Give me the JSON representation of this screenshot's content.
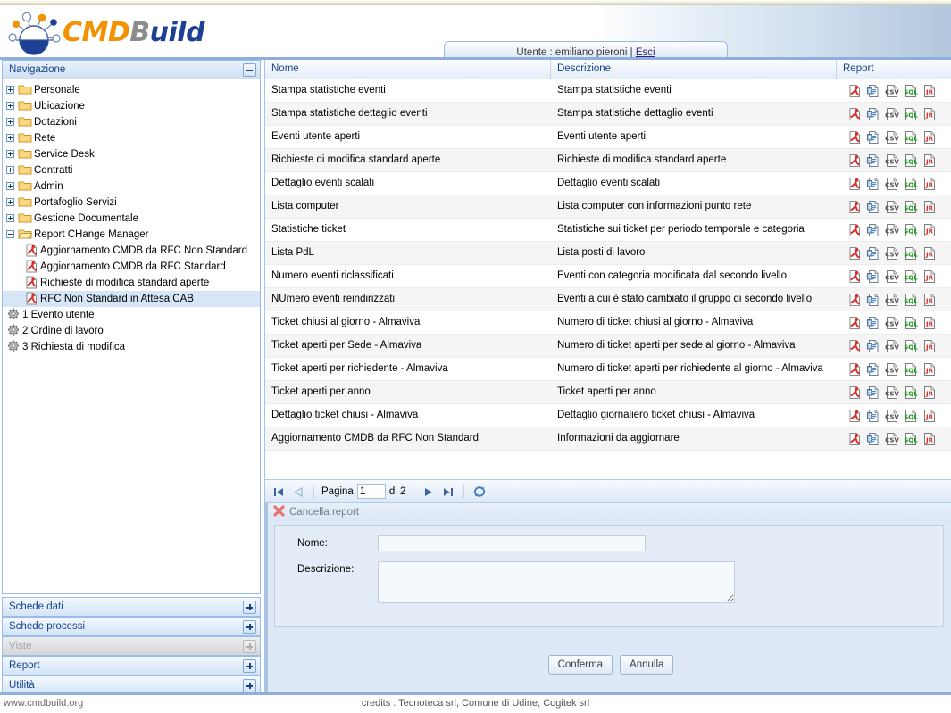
{
  "brand": {
    "name_part1": "CMD",
    "name_part2": "B",
    "name_part3": "uild",
    "colors": {
      "orange": "#f39200",
      "grey": "#8c8c8c",
      "blue": "#1d3f94"
    }
  },
  "header": {
    "user_prefix": "Utente : ",
    "user_name": "emiliano pieroni",
    "separator": " | ",
    "logout_label": "Esci"
  },
  "sidebar": {
    "title": "Navigazione",
    "tree": [
      {
        "label": "Personale",
        "icon": "folder-icon",
        "state": "plus",
        "depth": 0,
        "selected": false
      },
      {
        "label": "Ubicazione",
        "icon": "folder-icon",
        "state": "plus",
        "depth": 0,
        "selected": false
      },
      {
        "label": "Dotazioni",
        "icon": "folder-icon",
        "state": "plus",
        "depth": 0,
        "selected": false
      },
      {
        "label": "Rete",
        "icon": "folder-icon",
        "state": "plus",
        "depth": 0,
        "selected": false
      },
      {
        "label": "Service Desk",
        "icon": "folder-icon",
        "state": "plus",
        "depth": 0,
        "selected": false
      },
      {
        "label": "Contratti",
        "icon": "folder-icon",
        "state": "plus",
        "depth": 0,
        "selected": false
      },
      {
        "label": "Admin",
        "icon": "folder-icon",
        "state": "plus",
        "depth": 0,
        "selected": false
      },
      {
        "label": "Portafoglio Servizi",
        "icon": "folder-icon",
        "state": "plus",
        "depth": 0,
        "selected": false
      },
      {
        "label": "Gestione Documentale",
        "icon": "folder-icon",
        "state": "plus",
        "depth": 0,
        "selected": false
      },
      {
        "label": "Report CHange Manager",
        "icon": "folder-open-icon",
        "state": "minus",
        "depth": 0,
        "selected": false
      },
      {
        "label": "Aggiornamento CMDB da RFC Non Standard",
        "icon": "pdf-icon",
        "state": "none",
        "depth": 1,
        "selected": false
      },
      {
        "label": "Aggiornamento CMDB da RFC Standard",
        "icon": "pdf-icon",
        "state": "none",
        "depth": 1,
        "selected": false
      },
      {
        "label": "Richieste di modifica standard aperte",
        "icon": "pdf-icon",
        "state": "none",
        "depth": 1,
        "selected": false
      },
      {
        "label": "RFC Non Standard in Attesa CAB",
        "icon": "pdf-icon",
        "state": "none",
        "depth": 1,
        "selected": true
      },
      {
        "label": "1 Evento utente",
        "icon": "gear-icon",
        "state": "none",
        "depth": 0,
        "selected": false
      },
      {
        "label": "2 Ordine di lavoro",
        "icon": "gear-icon",
        "state": "none",
        "depth": 0,
        "selected": false
      },
      {
        "label": "3 Richiesta di modifica",
        "icon": "gear-icon",
        "state": "none",
        "depth": 0,
        "selected": false
      }
    ],
    "accordions": [
      {
        "label": "Schede dati",
        "disabled": false
      },
      {
        "label": "Schede processi",
        "disabled": false
      },
      {
        "label": "Viste",
        "disabled": true
      },
      {
        "label": "Report",
        "disabled": false
      },
      {
        "label": "Utilità",
        "disabled": false
      }
    ]
  },
  "grid": {
    "columns": [
      "Nome",
      "Descrizione",
      "Report"
    ],
    "report_icons": [
      "pdf-icon",
      "rtf-icon",
      "csv-icon",
      "sql-icon",
      "jr-icon"
    ],
    "rows": [
      {
        "nome": "Stampa statistiche eventi",
        "descrizione": "Stampa statistiche eventi"
      },
      {
        "nome": "Stampa statistiche dettaglio eventi",
        "descrizione": "Stampa statistiche dettaglio eventi"
      },
      {
        "nome": "Eventi utente aperti",
        "descrizione": "Eventi utente aperti"
      },
      {
        "nome": "Richieste di modifica standard aperte",
        "descrizione": "Richieste di modifica standard aperte"
      },
      {
        "nome": "Dettaglio eventi scalati",
        "descrizione": "Dettaglio eventi scalati"
      },
      {
        "nome": "Lista computer",
        "descrizione": "Lista computer con informazioni punto rete"
      },
      {
        "nome": "Statistiche ticket",
        "descrizione": "Statistiche sui ticket per periodo temporale e categoria"
      },
      {
        "nome": "Lista PdL",
        "descrizione": "Lista posti di lavoro"
      },
      {
        "nome": "Numero eventi riclassificati",
        "descrizione": "Eventi con categoria modificata dal secondo livello"
      },
      {
        "nome": "NUmero eventi reindirizzati",
        "descrizione": "Eventi a cui è stato cambiato il gruppo di secondo livello"
      },
      {
        "nome": "Ticket chiusi al giorno - Almaviva",
        "descrizione": "Numero di ticket chiusi al giorno - Almaviva"
      },
      {
        "nome": "Ticket aperti per Sede - Almaviva",
        "descrizione": "Numero di ticket aperti per sede al giorno - Almaviva"
      },
      {
        "nome": "Ticket aperti per richiedente - Almaviva",
        "descrizione": "Numero di ticket aperti per richiedente al giorno - Almaviva"
      },
      {
        "nome": "Ticket aperti per anno",
        "descrizione": "Ticket aperti per anno"
      },
      {
        "nome": "Dettaglio ticket chiusi - Almaviva",
        "descrizione": "Dettaglio giornaliero ticket chiusi - Almaviva"
      },
      {
        "nome": "Aggiornamento CMDB da RFC Non Standard",
        "descrizione": "Informazioni da aggiornare"
      }
    ]
  },
  "pager": {
    "first_icon": "first-page-icon",
    "prev_icon": "prev-page-icon",
    "page_label": "Pagina",
    "page_value": "1",
    "of_label": "di 2",
    "next_icon": "next-page-icon",
    "last_icon": "last-page-icon",
    "refresh_icon": "refresh-icon"
  },
  "form": {
    "title": "Cancella report",
    "title_icon": "delete-x-icon",
    "nome_label": "Nome:",
    "nome_value": "",
    "descrizione_label": "Descrizione:",
    "descrizione_value": "",
    "confirm_label": "Conferma",
    "cancel_label": "Annulla"
  },
  "footer": {
    "site": "www.cmdbuild.org",
    "credits": "credits : Tecnoteca srl, Comune di Udine, Cogitek srl"
  }
}
